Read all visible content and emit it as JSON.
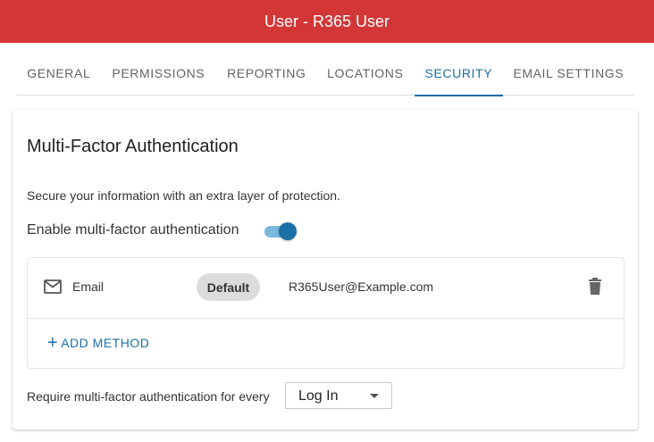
{
  "header": {
    "title": "User - R365 User",
    "bg_color": "#d23637"
  },
  "tabs": [
    {
      "label": "GENERAL",
      "active": false
    },
    {
      "label": "PERMISSIONS",
      "active": false
    },
    {
      "label": "REPORTING",
      "active": false
    },
    {
      "label": "LOCATIONS",
      "active": false
    },
    {
      "label": "SECURITY",
      "active": true
    },
    {
      "label": "EMAIL SETTINGS",
      "active": false
    }
  ],
  "mfa": {
    "title": "Multi-Factor Authentication",
    "description": "Secure your information with an extra layer of protection.",
    "enable_label": "Enable multi-factor authentication",
    "enabled": true,
    "methods": [
      {
        "icon": "mail-icon",
        "type": "Email",
        "badge": "Default",
        "value": "R365User@Example.com",
        "delete_icon": "trash-icon"
      }
    ],
    "add_method": {
      "icon": "plus-icon",
      "label": "ADD METHOD"
    },
    "require_label": "Require multi-factor authentication for every",
    "require_select": {
      "selected": "Log In"
    },
    "accent_color": "#1a6fa6"
  }
}
